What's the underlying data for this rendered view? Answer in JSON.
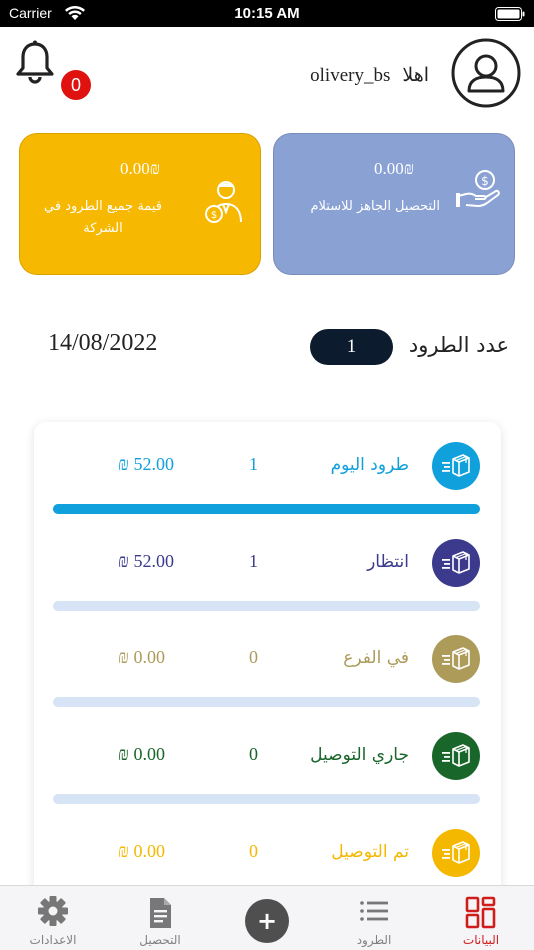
{
  "status_bar": {
    "carrier": "Carrier",
    "time": "10:15 AM"
  },
  "header": {
    "notification_count": "0",
    "greeting_word": "اهلا",
    "username": "olivery_bs"
  },
  "cards": {
    "ready_collection": {
      "amount": "0.00₪",
      "label": "التحصيل الجاهز للاستلام",
      "color": "#8aa1d4"
    },
    "all_parcels_value": {
      "amount": "0.00₪",
      "label": "قيمة جميع الطرود في الشركة",
      "color": "#f6b800"
    }
  },
  "summary": {
    "count_label": "عدد الطرود",
    "count_value": "1",
    "date": "14/08/2022"
  },
  "rows": [
    {
      "label": "طرود اليوم",
      "count": "1",
      "amount": "₪ 52.00",
      "color": "#10a0db",
      "text_color": "#10a0db",
      "progress": 1.0
    },
    {
      "label": "انتظار",
      "count": "1",
      "amount": "₪ 52.00",
      "color": "#3b3a8c",
      "text_color": "#3b3a8c",
      "progress": 0
    },
    {
      "label": "في الفرع",
      "count": "0",
      "amount": "₪ 0.00",
      "color": "#ad9b5a",
      "text_color": "#ad9b5a",
      "progress": 0
    },
    {
      "label": "جاري التوصيل",
      "count": "0",
      "amount": "₪ 0.00",
      "color": "#19662a",
      "text_color": "#19662a",
      "progress": 0
    },
    {
      "label": "تم التوصيل",
      "count": "0",
      "amount": "₪ 0.00",
      "color": "#f5b800",
      "text_color": "#f5b800",
      "progress": 0
    }
  ],
  "tabbar": {
    "data_label": "البيانات",
    "parcels_label": "الطرود",
    "collection_label": "التحصيل",
    "settings_label": "الاعدادات",
    "add_symbol": "+",
    "active_color": "#d11c1c"
  }
}
